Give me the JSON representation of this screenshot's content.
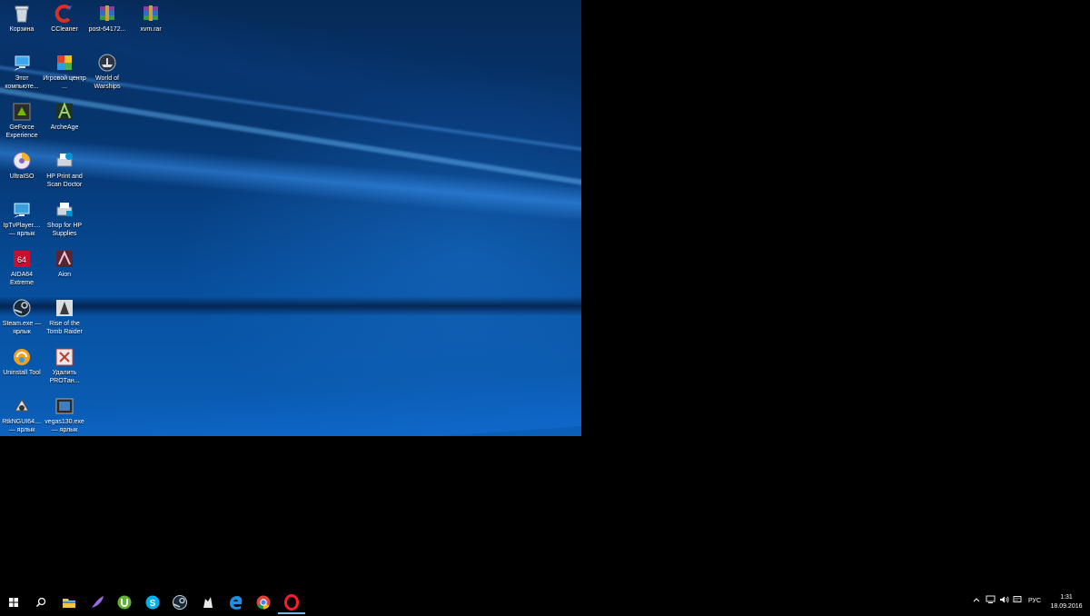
{
  "desktop": {
    "icons": [
      {
        "label": "Корзина",
        "icon": "recycle-bin-icon"
      },
      {
        "label": "CCleaner",
        "icon": "ccleaner-icon"
      },
      {
        "label": "post-64172...",
        "icon": "winrar-archive-icon"
      },
      {
        "label": "xvm.rar",
        "icon": "winrar-archive-icon"
      },
      {
        "label": "Этот компьюте...",
        "icon": "this-pc-icon"
      },
      {
        "label": "Игровой центр ...",
        "icon": "game-center-icon"
      },
      {
        "label": "World of Warships",
        "icon": "world-of-warships-icon"
      },
      {
        "label": "GeForce Experience",
        "icon": "geforce-experience-icon"
      },
      {
        "label": "ArcheAge",
        "icon": "archeage-icon"
      },
      {
        "label": "UltraISO",
        "icon": "ultraiso-icon"
      },
      {
        "label": "HP Print and Scan Doctor",
        "icon": "hp-print-scan-doctor-icon"
      },
      {
        "label": "IpTvPlayer.... — ярлык",
        "icon": "iptvplayer-icon"
      },
      {
        "label": "Shop for HP Supplies",
        "icon": "hp-shop-icon"
      },
      {
        "label": "AIDA64 Extreme",
        "icon": "aida64-icon"
      },
      {
        "label": "Aion",
        "icon": "aion-icon"
      },
      {
        "label": "Steam.exe — ярлык",
        "icon": "steam-icon"
      },
      {
        "label": "Rise of the Tomb Raider",
        "icon": "tomb-raider-icon"
      },
      {
        "label": "Uninstall Tool",
        "icon": "uninstall-tool-icon"
      },
      {
        "label": "Удалить PROTан...",
        "icon": "uninstall-protanki-icon"
      },
      {
        "label": "RtkNGUI64.... — ярлык",
        "icon": "realtek-audio-icon"
      },
      {
        "label": "vegas130.exe — ярлык",
        "icon": "vegas-icon"
      }
    ]
  },
  "taskbar": {
    "buttons": [
      {
        "icon": "windows-start-icon"
      },
      {
        "icon": "search-icon"
      },
      {
        "icon": "file-explorer-icon"
      },
      {
        "icon": "feather-app-icon"
      },
      {
        "icon": "utorrent-icon"
      },
      {
        "icon": "skype-icon"
      },
      {
        "icon": "steam-icon"
      },
      {
        "icon": "wolf-app-icon"
      },
      {
        "icon": "edge-icon"
      },
      {
        "icon": "chrome-icon"
      },
      {
        "icon": "opera-icon"
      }
    ],
    "tray": {
      "language": "РУС",
      "time": "1:31",
      "date": "18.09.2016"
    }
  },
  "colors": {
    "wallpaper_accent": "#0a5fb8",
    "taskbar_bg": "#000000",
    "active_indicator": "#76b9ed"
  }
}
